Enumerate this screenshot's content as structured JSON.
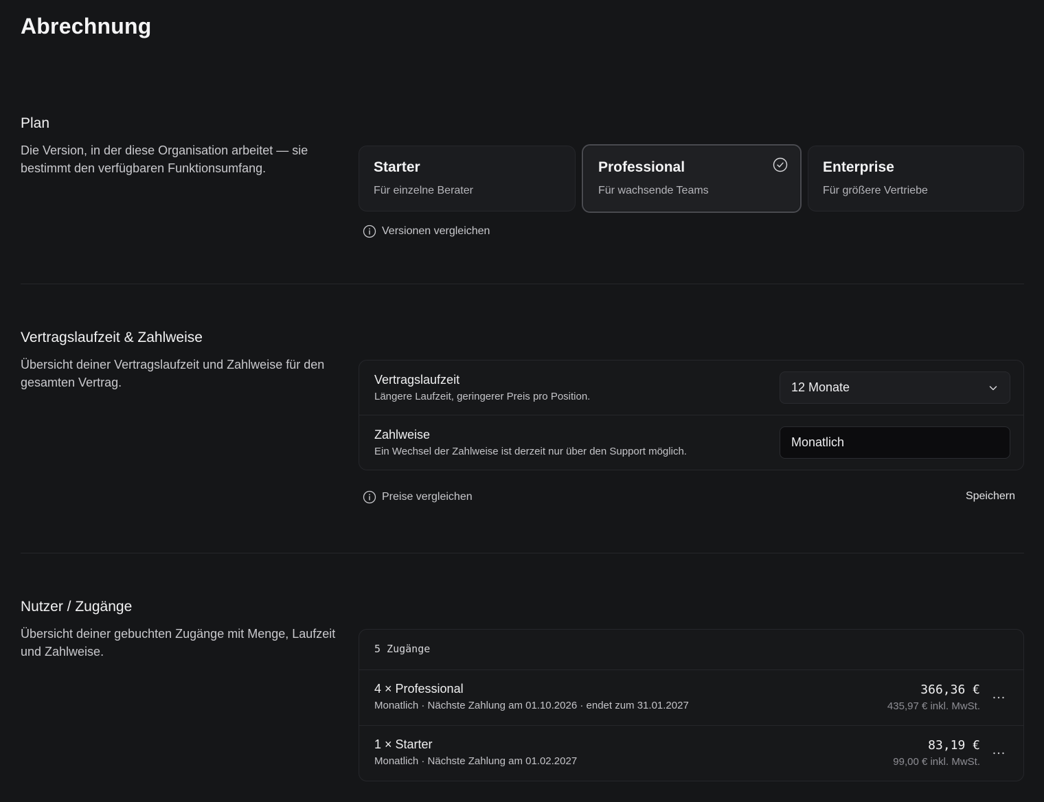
{
  "page": {
    "title": "Abrechnung"
  },
  "plan": {
    "title": "Plan",
    "description": "Die Version, in der diese Organisation arbeitet — sie bestimmt den verfügbaren Funktionsumfang.",
    "options": [
      {
        "name": "Starter",
        "subtitle": "Für einzelne Berater",
        "selected": false
      },
      {
        "name": "Professional",
        "subtitle": "Für wachsende Teams",
        "selected": true
      },
      {
        "name": "Enterprise",
        "subtitle": "Für größere Vertriebe",
        "selected": false
      }
    ],
    "compare_link": "Versionen vergleichen"
  },
  "contract": {
    "title": "Vertragslaufzeit & Zahlweise",
    "description": "Übersicht deiner Vertragslaufzeit und Zahlweise für den gesamten Vertrag.",
    "term": {
      "label": "Vertragslaufzeit",
      "hint": "Längere Laufzeit, geringerer Preis pro Position.",
      "value": "12 Monate"
    },
    "payment": {
      "label": "Zahlweise",
      "hint": "Ein Wechsel der Zahlweise ist derzeit nur über den Support möglich.",
      "value": "Monatlich"
    },
    "compare_link": "Preise vergleichen",
    "save_label": "Speichern"
  },
  "users": {
    "title": "Nutzer / Zugänge",
    "description": "Übersicht deiner gebuchten Zugänge mit Menge, Laufzeit und Zahlweise.",
    "count_label": "5 Zugänge",
    "rows": [
      {
        "title": "4 × Professional",
        "subtitle": "Monatlich · Nächste Zahlung am 01.10.2026 · endet zum 31.01.2027",
        "price": "366,36 €",
        "price_gross": "435,97 € inkl. MwSt."
      },
      {
        "title": "1 × Starter",
        "subtitle": "Monatlich · Nächste Zahlung am 01.02.2027",
        "price": "83,19 €",
        "price_gross": "99,00 € inkl. MwSt."
      }
    ]
  }
}
